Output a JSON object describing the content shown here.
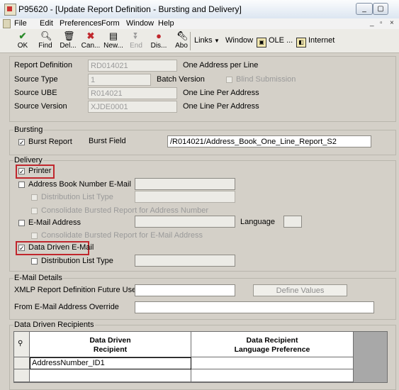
{
  "window": {
    "title": "P95620 - [Update Report Definition - Bursting and Delivery]",
    "controls": [
      "_",
      "▢",
      "✕"
    ],
    "doc_controls": [
      "_",
      "▫",
      "×"
    ]
  },
  "menu": [
    "File",
    "Edit",
    "Preferences",
    "Form",
    "Window",
    "Help"
  ],
  "toolbar": {
    "buttons": [
      {
        "label": "OK",
        "icon": "check-icon"
      },
      {
        "label": "Find",
        "icon": "find-icon"
      },
      {
        "label": "Del...",
        "icon": "delete-icon"
      },
      {
        "label": "Can...",
        "icon": "cancel-icon"
      },
      {
        "label": "New...",
        "icon": "new-icon"
      },
      {
        "label": "End",
        "icon": "end-icon"
      },
      {
        "label": "Dis...",
        "icon": "display-icon"
      },
      {
        "label": "Abo",
        "icon": "about-icon"
      }
    ],
    "links": [
      "Links",
      "Window",
      "OLE ...",
      "Internet"
    ]
  },
  "header": {
    "report_definition_label": "Report Definition",
    "report_definition_value": "RD014021",
    "report_definition_desc": "One Address per Line",
    "source_type_label": "Source Type",
    "source_type_value": "1",
    "source_type_desc": "Batch Version",
    "blind_submission_label": "Blind Submission",
    "source_ube_label": "Source UBE",
    "source_ube_value": "R014021",
    "source_ube_desc": "One Line Per Address",
    "source_version_label": "Source Version",
    "source_version_value": "XJDE0001",
    "source_version_desc": "One Line Per Address"
  },
  "bursting": {
    "group_title": "Bursting",
    "burst_report_label": "Burst Report",
    "burst_report_checked": true,
    "burst_field_label": "Burst Field",
    "burst_field_value": "/R014021/Address_Book_One_Line_Report_S2"
  },
  "delivery": {
    "group_title": "Delivery",
    "printer_label": "Printer",
    "printer_checked": true,
    "ab_email_label": "Address Book Number E-Mail",
    "dist_list_type_label": "Distribution List Type",
    "consolidate_address_label": "Consolidate Bursted Report for Address Number",
    "email_address_label": "E-Mail Address",
    "language_label": "Language",
    "consolidate_email_label": "Consolidate Bursted Report for E-Mail Address",
    "data_driven_label": "Data Driven E-Mail",
    "data_driven_checked": true,
    "dist_list_type2_label": "Distribution List Type"
  },
  "email_details": {
    "group_title": "E-Mail Details",
    "xmlp_label": "XMLP Report Definition Future Use",
    "define_values_button": "Define Values",
    "from_override_label": "From E-Mail Address Override"
  },
  "recipients": {
    "group_title": "Data Driven Recipients",
    "columns": [
      "Data Driven Recipient",
      "Data Recipient Language Preference"
    ],
    "col1_line1": "Data Driven",
    "col1_line2": "Recipient",
    "col2_line1": "Data Recipient",
    "col2_line2": "Language Preference",
    "rows": [
      [
        "AddressNumber_ID1",
        ""
      ]
    ]
  }
}
